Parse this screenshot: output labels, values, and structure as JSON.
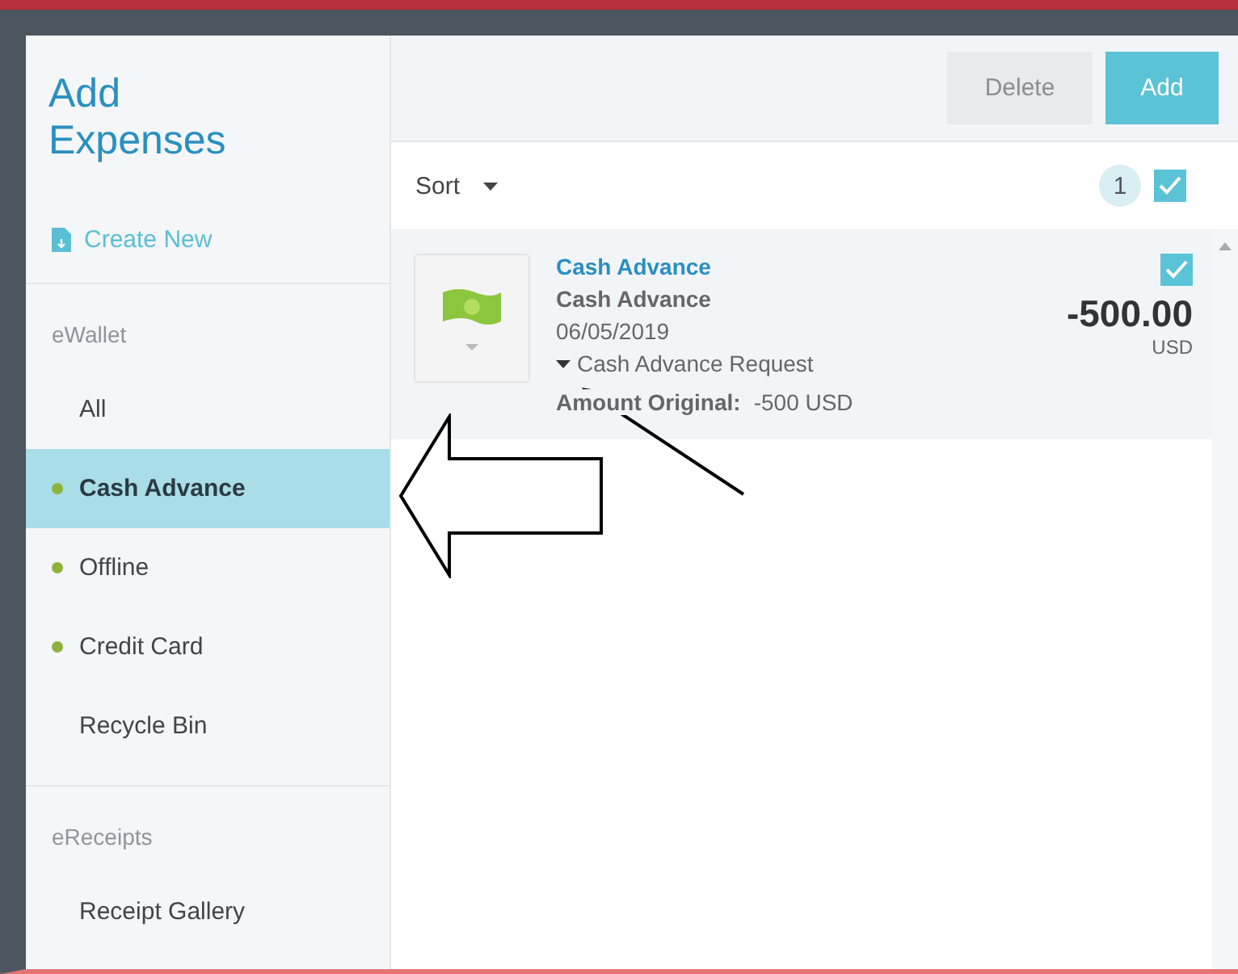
{
  "sidebar": {
    "title": "Add Expenses",
    "create_new": "Create New",
    "sections": [
      {
        "heading": "eWallet",
        "items": [
          {
            "label": "All",
            "dot": false,
            "selected": false
          },
          {
            "label": "Cash Advance",
            "dot": true,
            "selected": true
          },
          {
            "label": "Offline",
            "dot": true,
            "selected": false
          },
          {
            "label": "Credit Card",
            "dot": true,
            "selected": false
          },
          {
            "label": "Recycle Bin",
            "dot": false,
            "selected": false
          }
        ]
      },
      {
        "heading": "eReceipts",
        "items": [
          {
            "label": "Receipt Gallery",
            "dot": false,
            "selected": false
          }
        ]
      }
    ]
  },
  "toolbar": {
    "buttons": [
      {
        "label": "Delete",
        "disabled": true
      },
      {
        "label": "Add",
        "disabled": false
      }
    ]
  },
  "list_header": {
    "sort": "Sort",
    "count": "1",
    "select_all_checked": true
  },
  "expenses": [
    {
      "title": "Cash Advance",
      "type": "Cash Advance",
      "date": "06/05/2019",
      "request": "Cash Advance Request",
      "original_label": "Amount Original:",
      "original_value": "-500 USD",
      "amount": "-500.00",
      "currency": "USD",
      "checked": true
    }
  ]
}
